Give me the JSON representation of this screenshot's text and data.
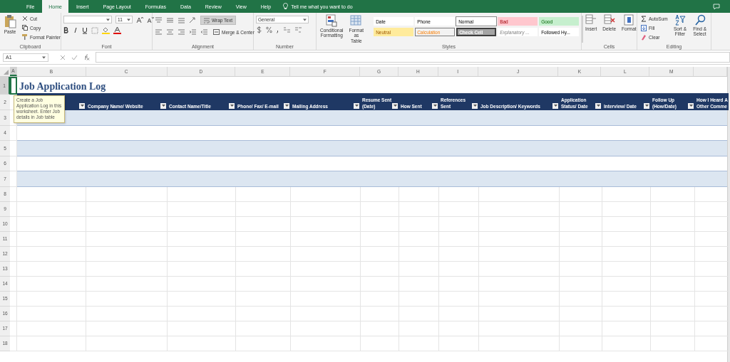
{
  "ribbon_tabs": [
    {
      "label": "File",
      "selected": false
    },
    {
      "label": "Home",
      "selected": true
    },
    {
      "label": "Insert",
      "selected": false
    },
    {
      "label": "Page Layout",
      "selected": false
    },
    {
      "label": "Formulas",
      "selected": false
    },
    {
      "label": "Data",
      "selected": false
    },
    {
      "label": "Review",
      "selected": false
    },
    {
      "label": "View",
      "selected": false
    },
    {
      "label": "Help",
      "selected": false
    }
  ],
  "tell_me": "Tell me what you want to do",
  "clipboard": {
    "paste": "Paste",
    "cut": "Cut",
    "copy": "Copy",
    "format_painter": "Format Painter",
    "label": "Clipboard"
  },
  "font": {
    "size": "11",
    "label": "Font"
  },
  "alignment": {
    "wrap_text": "Wrap Text",
    "wrap_on": true,
    "merge": "Merge & Center",
    "label": "Alignment"
  },
  "number": {
    "format": "General",
    "label": "Number"
  },
  "styles": {
    "conditional": "Conditional Formatting",
    "format_table": "Format as Table",
    "label": "Styles",
    "gallery": [
      {
        "label": "Date",
        "kind": "plain",
        "color": "#ffffff",
        "selected": false
      },
      {
        "label": "Phone",
        "kind": "plain",
        "color": "#ffffff",
        "selected": false
      },
      {
        "label": "Normal",
        "kind": "plain",
        "color": "#ffffff",
        "selected": true
      },
      {
        "label": "Bad",
        "kind": "bad",
        "color": "#ffc7ce",
        "selected": false
      },
      {
        "label": "Good",
        "kind": "good",
        "color": "#c6efce",
        "selected": false
      },
      {
        "label": "Neutral",
        "kind": "neutral",
        "color": "#ffeb9c",
        "selected": false
      },
      {
        "label": "Calculation",
        "kind": "calculation",
        "color": "#f2f2f2",
        "selected": false
      },
      {
        "label": "Check Cell",
        "kind": "check",
        "color": "#a5a5a5",
        "selected": false
      },
      {
        "label": "Explanatory ...",
        "kind": "explanatory",
        "color": "#ffffff",
        "selected": false
      },
      {
        "label": "Followed Hy...",
        "kind": "plain",
        "color": "#ffffff",
        "selected": false
      }
    ]
  },
  "cells": {
    "insert": "Insert",
    "delete": "Delete",
    "format": "Format",
    "label": "Cells"
  },
  "editing": {
    "autosum": "AutoSum",
    "fill": "Fill",
    "clear": "Clear",
    "sort": "Sort & Filter",
    "find": "Find & Select",
    "label": "Editing"
  },
  "formula_bar": {
    "name_box": "A1"
  },
  "sheet": {
    "title": "Job Application Log",
    "columns": [
      {
        "label": "A",
        "selected": true
      },
      {
        "label": "B",
        "selected": false
      },
      {
        "label": "C",
        "selected": false
      },
      {
        "label": "D",
        "selected": false
      },
      {
        "label": "E",
        "selected": false
      },
      {
        "label": "F",
        "selected": false
      },
      {
        "label": "G",
        "selected": false
      },
      {
        "label": "H",
        "selected": false
      },
      {
        "label": "I",
        "selected": false
      },
      {
        "label": "J",
        "selected": false
      },
      {
        "label": "K",
        "selected": false
      },
      {
        "label": "L",
        "selected": false
      },
      {
        "label": "M",
        "selected": false
      },
      {
        "selected": false
      }
    ],
    "table_header": [
      {
        "filter": true
      },
      {
        "label": "Company Name/ Website",
        "filter": true
      },
      {
        "label": "Contact Name/Title",
        "filter": true
      },
      {
        "label": "Phone/ Fax/ E-mail",
        "filter": true
      },
      {
        "label": "Mailing Address",
        "filter": true
      },
      {
        "top": "Resume Sent",
        "label": "(Date)",
        "filter": true
      },
      {
        "label": "How  Sent",
        "filter": true
      },
      {
        "top": "References",
        "label": "Sent",
        "filter": true
      },
      {
        "label": "Job Description/ Keywords",
        "filter": true
      },
      {
        "top": "Application",
        "label": "Status/ Date",
        "filter": true
      },
      {
        "label": "Interview/ Date",
        "filter": true
      },
      {
        "top": "Follow Up",
        "label": "(How/Date)",
        "filter": true
      },
      {
        "top": "How I Heard A",
        "label": "Other Comme",
        "filter": false
      }
    ],
    "rows": [
      {
        "label": "1",
        "kind": "title",
        "selected": true
      },
      {
        "label": "2",
        "kind": "header",
        "selected": false
      },
      {
        "label": "3",
        "kind": "body",
        "banded": true,
        "selected": false
      },
      {
        "label": "4",
        "kind": "body",
        "banded": false,
        "selected": false
      },
      {
        "label": "5",
        "kind": "body",
        "banded": true,
        "selected": false
      },
      {
        "label": "6",
        "kind": "body",
        "banded": false,
        "selected": false
      },
      {
        "label": "7",
        "kind": "body",
        "banded": true,
        "selected": false
      },
      {
        "label": "8",
        "kind": "plain",
        "selected": false
      },
      {
        "label": "9",
        "kind": "plain",
        "selected": false
      },
      {
        "label": "10",
        "kind": "plain",
        "selected": false
      },
      {
        "label": "11",
        "kind": "plain",
        "selected": false
      },
      {
        "label": "12",
        "kind": "plain",
        "selected": false
      },
      {
        "label": "13",
        "kind": "plain",
        "selected": false
      },
      {
        "label": "14",
        "kind": "plain",
        "selected": false
      },
      {
        "label": "15",
        "kind": "plain",
        "selected": false
      },
      {
        "label": "16",
        "kind": "plain",
        "selected": false
      },
      {
        "label": "17",
        "kind": "plain",
        "selected": false
      },
      {
        "label": "18",
        "kind": "plain",
        "selected": false
      }
    ]
  },
  "tooltip": "Create a Job Application Log in this worksheet. Enter Job details in Job table"
}
